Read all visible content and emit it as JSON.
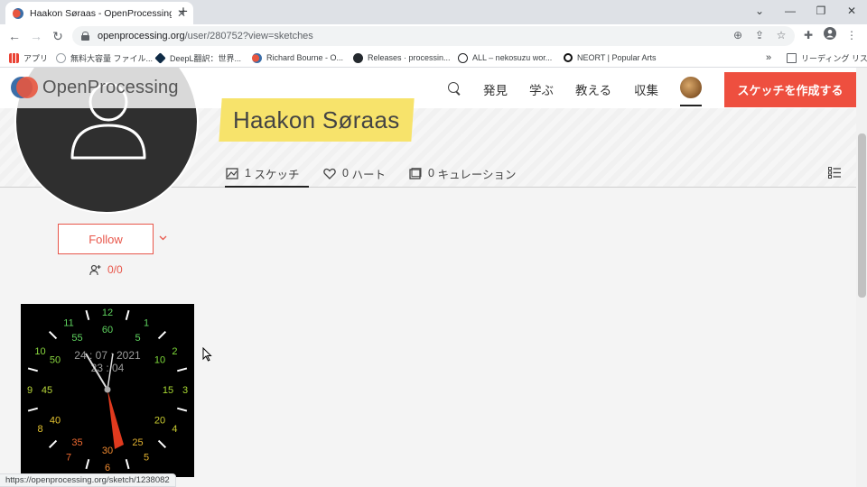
{
  "browser": {
    "tab_title": "Haakon Søraas - OpenProcessing",
    "tab_close": "✕",
    "new_tab": "+",
    "url_host": "openprocessing.org",
    "url_path": "/user/280752?view=sketches",
    "status_url": "https://openprocessing.org/sketch/1238082",
    "bookmarks": [
      {
        "label": "アプリ",
        "color": "#4285f4"
      },
      {
        "label": "無料大容量 ファイル...",
        "color": "#9aa0a6"
      },
      {
        "label": "DeepL翻訳：世界...",
        "color": "#0f2b46"
      },
      {
        "label": "Richard Bourne - O...",
        "color": "#e8563f"
      },
      {
        "label": "Releases · processin...",
        "color": "#24292e"
      },
      {
        "label": "ALL – nekosuzu wor...",
        "color": "#202124"
      },
      {
        "label": "NEORT | Popular Arts",
        "color": "#111111"
      }
    ],
    "bookmarks_more": "»",
    "reading_list": "リーディング リスト"
  },
  "site": {
    "logo_text": "OpenProcessing",
    "nav": [
      "発見",
      "学ぶ",
      "教える",
      "収集"
    ],
    "create_button": "スケッチを作成する"
  },
  "profile": {
    "username": "Haakon Søraas",
    "tabs": [
      {
        "count": "1",
        "label": "スケッチ"
      },
      {
        "count": "0",
        "label": "ハート"
      },
      {
        "count": "0",
        "label": "キュレーション"
      }
    ],
    "follow_label": "Follow",
    "followers": "0/0"
  },
  "sketch": {
    "date_line": "24 : 07 : 2021",
    "time_line": "23 : 04",
    "hour_labels": [
      "12",
      "1",
      "2",
      "3",
      "4",
      "5",
      "6",
      "7",
      "8",
      "9",
      "10",
      "11"
    ],
    "minute_labels": [
      "60",
      "5",
      "10",
      "15",
      "20",
      "25",
      "30",
      "35",
      "40",
      "45",
      "50",
      "55"
    ]
  },
  "colors": {
    "accent": "#ee4f3f",
    "follow": "#e8564a",
    "name_band": "#f7e36b"
  }
}
